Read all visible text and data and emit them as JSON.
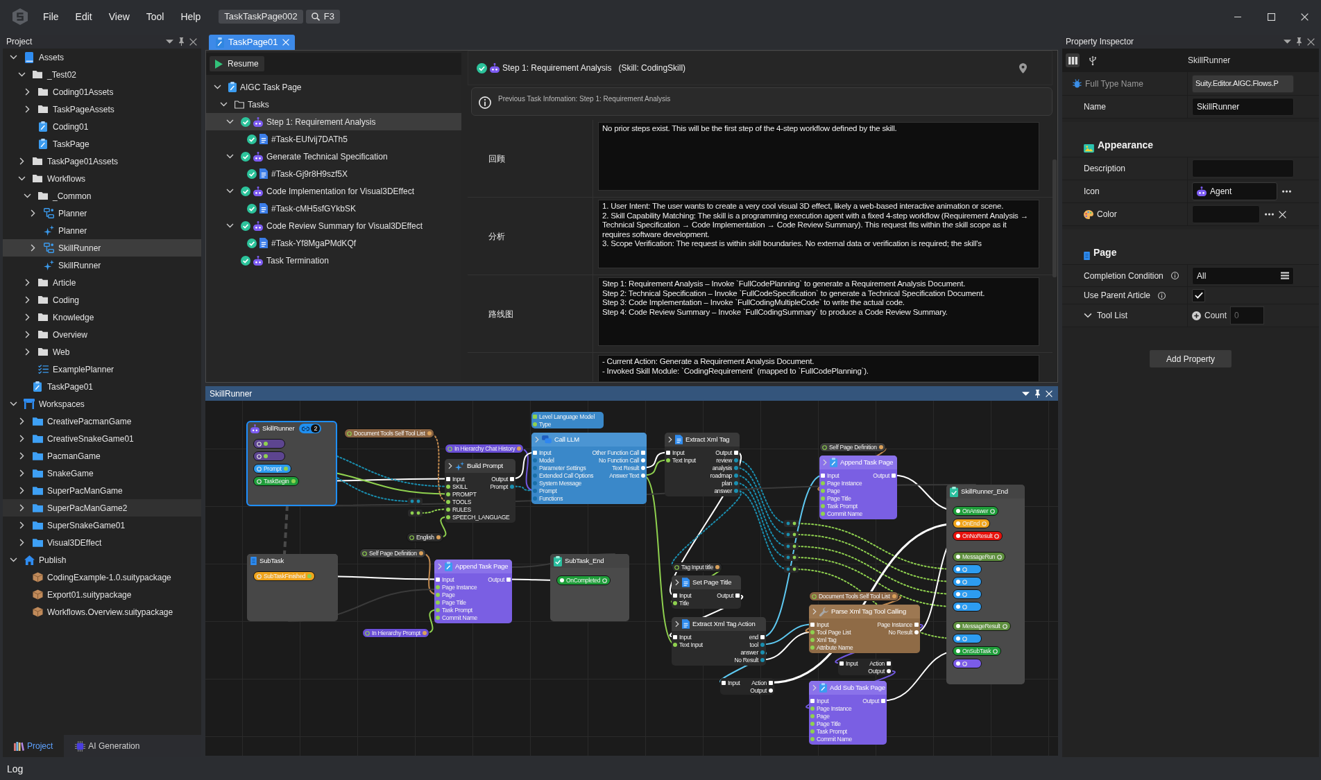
{
  "menu": {
    "items": [
      "File",
      "Edit",
      "View",
      "Tool",
      "Help"
    ],
    "document": "TaskTaskPage002",
    "search_shortcut": "F3"
  },
  "project_panel": {
    "title": "Project",
    "tree": [
      {
        "label": "Assets",
        "kind": "assets",
        "selected": false,
        "hovered": false,
        "expanded": true,
        "children": [
          {
            "label": "_Test02",
            "kind": "folder",
            "selected": false,
            "hovered": false,
            "expanded": true,
            "children": [
              {
                "label": "Coding01Assets",
                "kind": "folder",
                "selected": false,
                "hovered": false,
                "expanded": false
              },
              {
                "label": "TaskPageAssets",
                "kind": "folder",
                "selected": false,
                "hovered": false,
                "expanded": false
              },
              {
                "label": "Coding01",
                "kind": "task_page",
                "selected": false,
                "hovered": false
              },
              {
                "label": "TaskPage",
                "kind": "task_page",
                "selected": false,
                "hovered": false
              }
            ]
          },
          {
            "label": "TaskPage01Assets",
            "kind": "folder",
            "selected": false,
            "hovered": false,
            "expanded": false
          },
          {
            "label": "Workflows",
            "kind": "folder",
            "selected": false,
            "hovered": false,
            "expanded": true,
            "children": [
              {
                "label": "_Common",
                "kind": "folder",
                "selected": false,
                "hovered": false,
                "expanded": true,
                "children": [
                  {
                    "label": "Planner",
                    "kind": "workflow",
                    "selected": false,
                    "hovered": false,
                    "expanded": false
                  },
                  {
                    "label": "Planner",
                    "kind": "skill",
                    "selected": false,
                    "hovered": false
                  },
                  {
                    "label": "SkillRunner",
                    "kind": "workflow",
                    "selected": true,
                    "hovered": false,
                    "expanded": false
                  },
                  {
                    "label": "SkillRunner",
                    "kind": "skill",
                    "selected": false,
                    "hovered": false
                  }
                ]
              },
              {
                "label": "Article",
                "kind": "folder",
                "selected": false,
                "hovered": false,
                "expanded": false
              },
              {
                "label": "Coding",
                "kind": "folder",
                "selected": false,
                "hovered": false,
                "expanded": false
              },
              {
                "label": "Knowledge",
                "kind": "folder",
                "selected": false,
                "hovered": false,
                "expanded": false
              },
              {
                "label": "Overview",
                "kind": "folder",
                "selected": false,
                "hovered": false,
                "expanded": false
              },
              {
                "label": "Web",
                "kind": "folder",
                "selected": false,
                "hovered": false,
                "expanded": false
              },
              {
                "label": "ExamplePlanner",
                "kind": "planner",
                "selected": false,
                "hovered": false
              }
            ]
          },
          {
            "label": "TaskPage01",
            "kind": "task_page",
            "selected": false,
            "hovered": false
          }
        ]
      },
      {
        "label": "Workspaces",
        "kind": "workspaces",
        "selected": false,
        "hovered": false,
        "expanded": true,
        "children": [
          {
            "label": "CreativePacmanGame",
            "kind": "workspace",
            "selected": false,
            "hovered": false,
            "expanded": false
          },
          {
            "label": "CreativeSnakeGame01",
            "kind": "workspace",
            "selected": false,
            "hovered": false,
            "expanded": false
          },
          {
            "label": "PacmanGame",
            "kind": "workspace",
            "selected": false,
            "hovered": false,
            "expanded": false
          },
          {
            "label": "SnakeGame",
            "kind": "workspace",
            "selected": false,
            "hovered": false,
            "expanded": false
          },
          {
            "label": "SuperPacManGame",
            "kind": "workspace",
            "selected": false,
            "hovered": false,
            "expanded": false
          },
          {
            "label": "SuperPacManGame2",
            "kind": "workspace",
            "selected": false,
            "hovered": true,
            "expanded": false
          },
          {
            "label": "SuperSnakeGame01",
            "kind": "workspace",
            "selected": false,
            "hovered": false,
            "expanded": false
          },
          {
            "label": "Visual3DEffect",
            "kind": "workspace",
            "selected": false,
            "hovered": false,
            "expanded": false
          }
        ]
      },
      {
        "label": "Publish",
        "kind": "publish",
        "selected": false,
        "hovered": false,
        "expanded": true,
        "children": [
          {
            "label": "CodingExample-1.0.suitypackage",
            "kind": "package",
            "selected": false,
            "hovered": false
          },
          {
            "label": "Export01.suitypackage",
            "kind": "package",
            "selected": false,
            "hovered": false
          },
          {
            "label": "Workflows.Overview.suitypackage",
            "kind": "package",
            "selected": false,
            "hovered": false
          }
        ]
      }
    ],
    "tabs": [
      {
        "label": "Project",
        "selected": true
      },
      {
        "label": "AI Generation",
        "selected": false
      }
    ]
  },
  "document_tabs": [
    {
      "label": "TaskPage01",
      "selected": true
    }
  ],
  "task_page": {
    "toolbar_button": "Resume",
    "tree": [
      {
        "label": "AIGC Task Page",
        "kind": "page",
        "done": false,
        "selected": false,
        "expanded": true,
        "children": [
          {
            "label": "Tasks",
            "kind": "folder",
            "done": false,
            "selected": false,
            "expanded": true,
            "children": [
              {
                "label": "Step 1: Requirement Analysis",
                "kind": "agent",
                "done": true,
                "selected": true,
                "expanded": true,
                "children": [
                  {
                    "label": "#Task-EUfvij7DATh5",
                    "kind": "task",
                    "done": true,
                    "selected": false
                  }
                ]
              },
              {
                "label": "Generate Technical Specification",
                "kind": "agent",
                "done": true,
                "selected": false,
                "expanded": true,
                "children": [
                  {
                    "label": "#Task-Gj9r8H9szf5X",
                    "kind": "task",
                    "done": true,
                    "selected": false
                  }
                ]
              },
              {
                "label": "Code Implementation for Visual3DEffect",
                "kind": "agent",
                "done": true,
                "selected": false,
                "expanded": true,
                "children": [
                  {
                    "label": "#Task-cMH5sfGYkbSK",
                    "kind": "task",
                    "done": true,
                    "selected": false
                  }
                ]
              },
              {
                "label": "Code Review Summary for Visual3DEffect",
                "kind": "agent",
                "done": true,
                "selected": false,
                "expanded": true,
                "children": [
                  {
                    "label": "#Task-Yf8MgaPMdKQf",
                    "kind": "task",
                    "done": true,
                    "selected": false
                  }
                ]
              },
              {
                "label": "Task Termination",
                "kind": "agent",
                "done": true,
                "selected": false
              }
            ]
          }
        ]
      }
    ],
    "header": {
      "done": true,
      "title": "Step 1: Requirement Analysis",
      "skill": "(Skill: CodingSkill)"
    },
    "info": "Previous Task Infomation: Step 1: Requirement Analysis",
    "sections": [
      {
        "label": "回顾",
        "text": "No prior steps exist. This will be the first step of the 4-step workflow defined by the skill."
      },
      {
        "label": "分析",
        "text": "1. User Intent: The user wants to create a very cool visual 3D effect, likely a web-based interactive animation or scene.\n2. Skill Capability Matching: The skill is a programming execution agent with a fixed 4-step workflow (Requirement Analysis → Technical Specification → Code Implementation → Code Review Summary). This request fits within the skill scope as it requires software development.\n3. Scope Verification: The request is within skill boundaries. No external data or verification is required; the skill's"
      },
      {
        "label": "路线图",
        "text": "Step 1: Requirement Analysis – Invoke `FullCodePlanning` to generate a Requirement Analysis Document.\nStep 2: Technical Specification – Invoke `FullCodeSpecification` to generate a Technical Specification Document.\nStep 3: Code Implementation – Invoke `FullCodingMultipleCode` to write the actual code.\nStep 4: Code Review Summary – Invoke `FullCodingSummary` to produce a Code Review Summary."
      },
      {
        "text": "- Current Action: Generate a Requirement Analysis Document.\n- Invoked Skill Module: `CodingRequirement` (mapped to `FullCodePlanning`)."
      }
    ]
  },
  "graph": {
    "title": "SkillRunner",
    "nodes": [
      {
        "kind": "begin",
        "title": "SkillRunner",
        "selected": true,
        "badge": "2",
        "chips": [
          {
            "color": "#5d4590"
          },
          {
            "color": "#5d4590"
          },
          {
            "label": "Prompt",
            "color": "#2d9cf0"
          },
          {
            "label": "TaskBegin",
            "color": "#1f9e3a"
          }
        ]
      },
      {
        "kind": "params",
        "selected": false,
        "inputs": [
          "Level Language Model",
          "Type"
        ]
      },
      {
        "kind": "flow",
        "title": "Build Prompt",
        "selected": false,
        "inputs": [
          "Input",
          "SKILL",
          "PROMPT",
          "TOOLS",
          "RULES",
          "SPEECH_LANGUAGE"
        ],
        "outputs": [
          "Output",
          "Prompt"
        ]
      },
      {
        "kind": "llm",
        "title": "Call LLM",
        "selected": false,
        "inputs": [
          "Input",
          "Model",
          "Parameter Settings",
          "Extended Call Options",
          "System Message",
          "Prompt",
          "Functions"
        ],
        "outputs": [
          "Other Function Call",
          "No Function Call",
          "Text Result",
          "Answer Text"
        ]
      },
      {
        "kind": "flow",
        "title": "Extract Xml Tag",
        "selected": false,
        "inputs": [
          "Input",
          "Text Input"
        ],
        "outputs": [
          "Output",
          "review",
          "analysis",
          "roadmap",
          "plan",
          "answer"
        ]
      },
      {
        "kind": "page",
        "title": "Append Task Page",
        "selected": false,
        "inputs": [
          "Input",
          "Page Instance",
          "Page",
          "Page Title",
          "Task Prompt",
          "Commit Name"
        ],
        "outputs": [
          "Output"
        ]
      },
      {
        "kind": "begin",
        "title": "SubTask",
        "selected": false,
        "chips": [
          {
            "label": "SubTaskFinished",
            "color": "#f0a41c"
          }
        ]
      },
      {
        "kind": "page",
        "title": "Append Task Page",
        "selected": false,
        "inputs": [
          "Input",
          "Page Instance",
          "Page",
          "Page Title",
          "Task Prompt",
          "Commit Name"
        ],
        "outputs": [
          "Output"
        ]
      },
      {
        "kind": "end",
        "title": "SubTask_End",
        "selected": false,
        "chips": [
          {
            "label": "OnCompleted",
            "color": "#1f9e3a"
          }
        ]
      },
      {
        "kind": "flow",
        "title": "Set Page Title",
        "selected": false,
        "inputs": [
          "Input",
          "Title"
        ],
        "outputs": [
          "Output"
        ]
      },
      {
        "kind": "flow",
        "title": "Extract Xml Tag Action",
        "selected": false,
        "inputs": [
          "Input",
          "Text Input"
        ],
        "outputs": [
          "end",
          "tool",
          "answer",
          "No Result"
        ]
      },
      {
        "kind": "mini",
        "selected": false,
        "inputs": [
          "Input"
        ],
        "outputs": [
          "Action",
          "Output"
        ]
      },
      {
        "kind": "tool",
        "title": "Parse Xml Tag Tool Calling",
        "selected": false,
        "inputs": [
          "Input",
          "Tool Page List",
          "Xml Tag",
          "Attribute Name"
        ],
        "outputs": [
          "Page Instance",
          "No Result"
        ]
      },
      {
        "kind": "mini",
        "selected": false,
        "inputs": [
          "Input"
        ],
        "outputs": [
          "Action",
          "Output"
        ]
      },
      {
        "kind": "page",
        "title": "Add Sub Task Page",
        "selected": false,
        "inputs": [
          "Input",
          "Page Instance",
          "Page",
          "Page Title",
          "Task Prompt",
          "Commit Name"
        ],
        "outputs": [
          "Output"
        ]
      },
      {
        "kind": "end",
        "title": "SkillRunner_End",
        "selected": false,
        "chips": [
          {
            "label": "OnAnswer",
            "color": "#1f9e3a"
          },
          {
            "label": "OnEnd",
            "color": "#f0a41c"
          },
          {
            "label": "OnNoResult",
            "color": "#e8120c"
          },
          {
            "label": "MessageRun",
            "color": "#5e8f3e"
          },
          {
            "color": "#2d9cf0"
          },
          {
            "color": "#2d9cf0"
          },
          {
            "color": "#2d9cf0"
          },
          {
            "color": "#2d9cf0"
          },
          {
            "label": "MessageResult",
            "color": "#5e8f3e"
          },
          {
            "color": "#2d9cf0"
          },
          {
            "label": "OnSubTask",
            "color": "#1f9e3a"
          },
          {
            "color": "#7b5ce8"
          }
        ]
      }
    ],
    "pills": [
      {
        "label": "Document Tools Self Tool List",
        "color": "#8a6443"
      },
      {
        "label": "In Hierarchy Chat History",
        "color": "#6a4fd6"
      },
      {
        "label": "Self Page Definition",
        "color": "#3d3d3d"
      },
      {
        "label": "English",
        "color": "#2c2c2c"
      },
      {
        "label": "Self Page Definition",
        "color": "#3d3d3d"
      },
      {
        "label": "Tag Input title",
        "color": "#2c2c2c"
      },
      {
        "label": "Document Tools Self Tool List",
        "color": "#8a6443"
      },
      {
        "label": "In Hierarchy Prompt",
        "color": "#6a4fd6"
      }
    ]
  },
  "property_inspector": {
    "title": "Property Inspector",
    "object_name": "SkillRunner",
    "rows": [
      {
        "kind": "readonly",
        "label": "Full Type Name",
        "value": "Suity.Editor.AIGC.Flows.P"
      },
      {
        "kind": "text",
        "label": "Name",
        "value": "SkillRunner"
      }
    ],
    "sections": [
      {
        "title": "Appearance",
        "rows": [
          {
            "kind": "text",
            "label": "Description"
          },
          {
            "kind": "icon",
            "label": "Icon",
            "value": "Agent"
          },
          {
            "kind": "color",
            "label": "Color"
          }
        ]
      },
      {
        "title": "Page",
        "rows": [
          {
            "kind": "select",
            "label": "Completion Condition",
            "info": true,
            "value": "All"
          },
          {
            "kind": "checkbox",
            "label": "Use Parent Article",
            "info": true,
            "checked": true
          },
          {
            "kind": "list",
            "label": "Tool List",
            "expanded": true,
            "count_label": "Count",
            "placeholder": "0"
          }
        ]
      }
    ],
    "add_button": "Add Property"
  },
  "log_panel": {
    "title": "Log"
  }
}
